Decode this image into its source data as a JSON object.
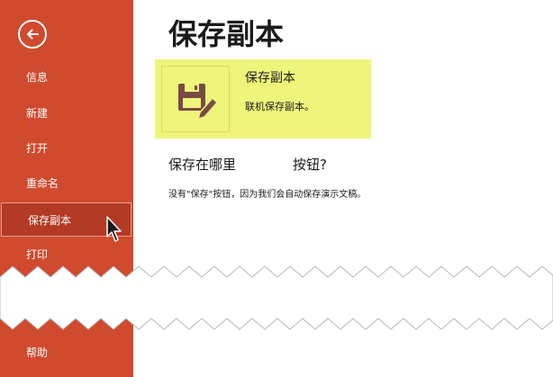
{
  "sidebar": {
    "items": [
      {
        "label": "信息"
      },
      {
        "label": "新建"
      },
      {
        "label": "打开"
      },
      {
        "label": "重命名"
      },
      {
        "label": "保存副本"
      },
      {
        "label": "打印"
      },
      {
        "label": "帮助"
      }
    ]
  },
  "main": {
    "title": "保存副本",
    "option": {
      "title": "保存副本",
      "description": "联机保存副本。"
    },
    "where_label": "保存在哪里",
    "button_label": "按钮?",
    "note": "没有\"保存\"按钮，因为我们会自动保存演示文稿。"
  },
  "colors": {
    "sidebar_bg": "#d04a2e",
    "sidebar_active": "#b33a24",
    "highlight": "#eff47a",
    "icon": "#7a4a45"
  },
  "icons": {
    "back": "back-arrow-circle-icon",
    "option": "save-edit-icon"
  }
}
